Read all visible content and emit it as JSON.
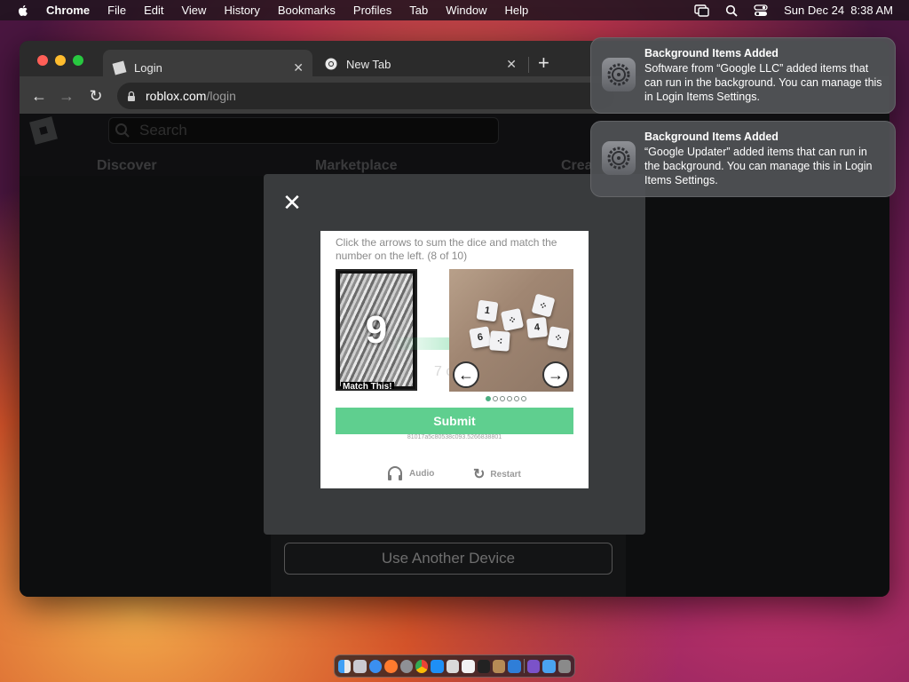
{
  "menubar": {
    "app_name": "Chrome",
    "items": [
      "File",
      "Edit",
      "View",
      "History",
      "Bookmarks",
      "Profiles",
      "Tab",
      "Window",
      "Help"
    ],
    "datetime": "Sun Dec 24  8:38 AM"
  },
  "browser": {
    "tabs": [
      {
        "label": "Login",
        "icon": "roblox-favicon-icon"
      },
      {
        "label": "New Tab",
        "icon": "chrome-icon"
      }
    ],
    "url": {
      "host": "roblox.com",
      "path": "/login"
    }
  },
  "roblox": {
    "search_placeholder": "Search",
    "nav": [
      "Discover",
      "Marketplace",
      "Crea"
    ],
    "another_device_label": "Use Another Device"
  },
  "captcha": {
    "instruction": "Click the arrows to sum the dice and match the number on the left. (8 of 10)",
    "target_number": "9",
    "match_label": "Match This!",
    "ghost_text": "7 c",
    "submit_label": "Submit",
    "session_id": "81017a5c80538c093.5266838801",
    "audio_label": "Audio",
    "restart_label": "Restart",
    "dice_faces": [
      "1",
      "",
      "",
      "4",
      "",
      "6",
      ""
    ],
    "pagination": {
      "count": 6,
      "active_index": 0
    }
  },
  "notifications": [
    {
      "title": "Background Items Added",
      "body": "Software from “Google LLC” added items that can run in the background. You can manage this in Login Items Settings."
    },
    {
      "title": "Background Items Added",
      "body": "“Google Updater” added items that can run in the background. You can manage this in Login Items Settings."
    }
  ],
  "colors": {
    "submit_green": "#5fcf8f",
    "menubar": "#1e141e"
  }
}
